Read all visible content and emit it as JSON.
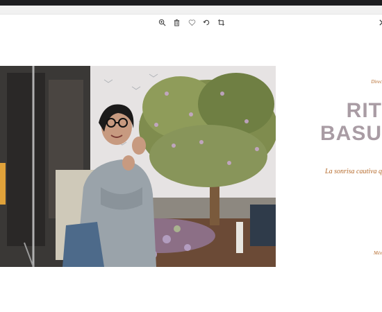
{
  "toolbar": {
    "icons": [
      "zoom-in-icon",
      "trash-icon",
      "heart-icon",
      "rotate-icon",
      "crop-icon",
      "close-icon"
    ]
  },
  "panel": {
    "kicker": "Direc",
    "title_line1": "RIT",
    "title_line2": "BASU",
    "tagline": "La sonrisa cautiva q",
    "footer": "Méx"
  },
  "colors": {
    "accent": "#b56a2b",
    "title": "#a99ca4",
    "topbar": "#1d1d1f"
  }
}
